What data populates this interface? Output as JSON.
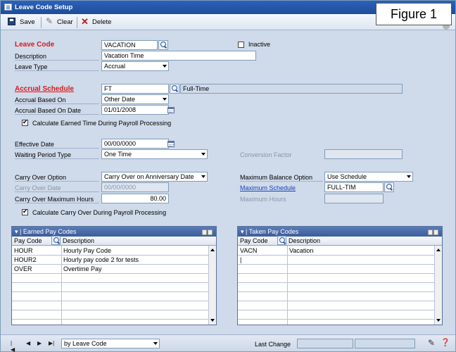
{
  "window": {
    "title": "Leave Code Setup"
  },
  "figure_label": "Figure 1",
  "toolbar": {
    "save": "Save",
    "clear": "Clear",
    "delete": "Delete"
  },
  "form": {
    "leave_code": {
      "label": "Leave Code",
      "value": "VACATION"
    },
    "inactive": {
      "label": "Inactive",
      "checked": false
    },
    "description": {
      "label": "Description",
      "value": "Vacation Time"
    },
    "leave_type": {
      "label": "Leave Type",
      "value": "Accrual"
    },
    "accrual_schedule": {
      "label": "Accrual Schedule",
      "value": "FT",
      "description": "Full-Time"
    },
    "accrual_based_on": {
      "label": "Accrual Based On",
      "value": "Other Date"
    },
    "accrual_based_on_date": {
      "label": "Accrual Based On Date",
      "value": "01/01/2008"
    },
    "calc_earned_time": {
      "label": "Calculate Earned Time During Payroll Processing",
      "checked": true
    },
    "effective_date": {
      "label": "Effective Date",
      "value": "00/00/0000"
    },
    "waiting_period_type": {
      "label": "Waiting Period Type",
      "value": "One Time"
    },
    "conversion_factor": {
      "label": "Conversion Factor",
      "value": ""
    },
    "carry_over_option": {
      "label": "Carry Over Option",
      "value": "Carry Over on Anniversary Date"
    },
    "carry_over_date": {
      "label": "Carry Over Date",
      "value": "00/00/0000"
    },
    "carry_over_max_hours": {
      "label": "Carry Over Maximum Hours",
      "value": "80.00"
    },
    "max_balance_option": {
      "label": "Maximum Balance Option",
      "value": "Use Schedule"
    },
    "max_schedule": {
      "label": "Maximum Schedule",
      "value": "FULL-TIM"
    },
    "max_hours": {
      "label": "Maximum Hours",
      "value": ""
    },
    "calc_carry_over": {
      "label": "Calculate Carry Over During Payroll Processing",
      "checked": true
    }
  },
  "earned_grid": {
    "title": "Earned Pay Codes",
    "columns": [
      "Pay Code",
      "Description"
    ],
    "rows": [
      [
        "HOUR",
        "Hourly Pay Code"
      ],
      [
        "HOUR2",
        "Hourly pay code 2 for tests"
      ],
      [
        "OVER",
        "Overtime Pay"
      ],
      [
        "",
        ""
      ],
      [
        "",
        ""
      ],
      [
        "",
        ""
      ],
      [
        "",
        ""
      ],
      [
        "",
        ""
      ]
    ]
  },
  "taken_grid": {
    "title": "Taken Pay Codes",
    "columns": [
      "Pay Code",
      "Description"
    ],
    "rows": [
      [
        "VACN",
        "Vacation"
      ],
      [
        "|",
        ""
      ],
      [
        "",
        ""
      ],
      [
        "",
        ""
      ],
      [
        "",
        ""
      ],
      [
        "",
        ""
      ],
      [
        "",
        ""
      ],
      [
        "",
        ""
      ]
    ]
  },
  "status": {
    "sort_value": "by Leave Code",
    "last_change_label": "Last Change"
  }
}
